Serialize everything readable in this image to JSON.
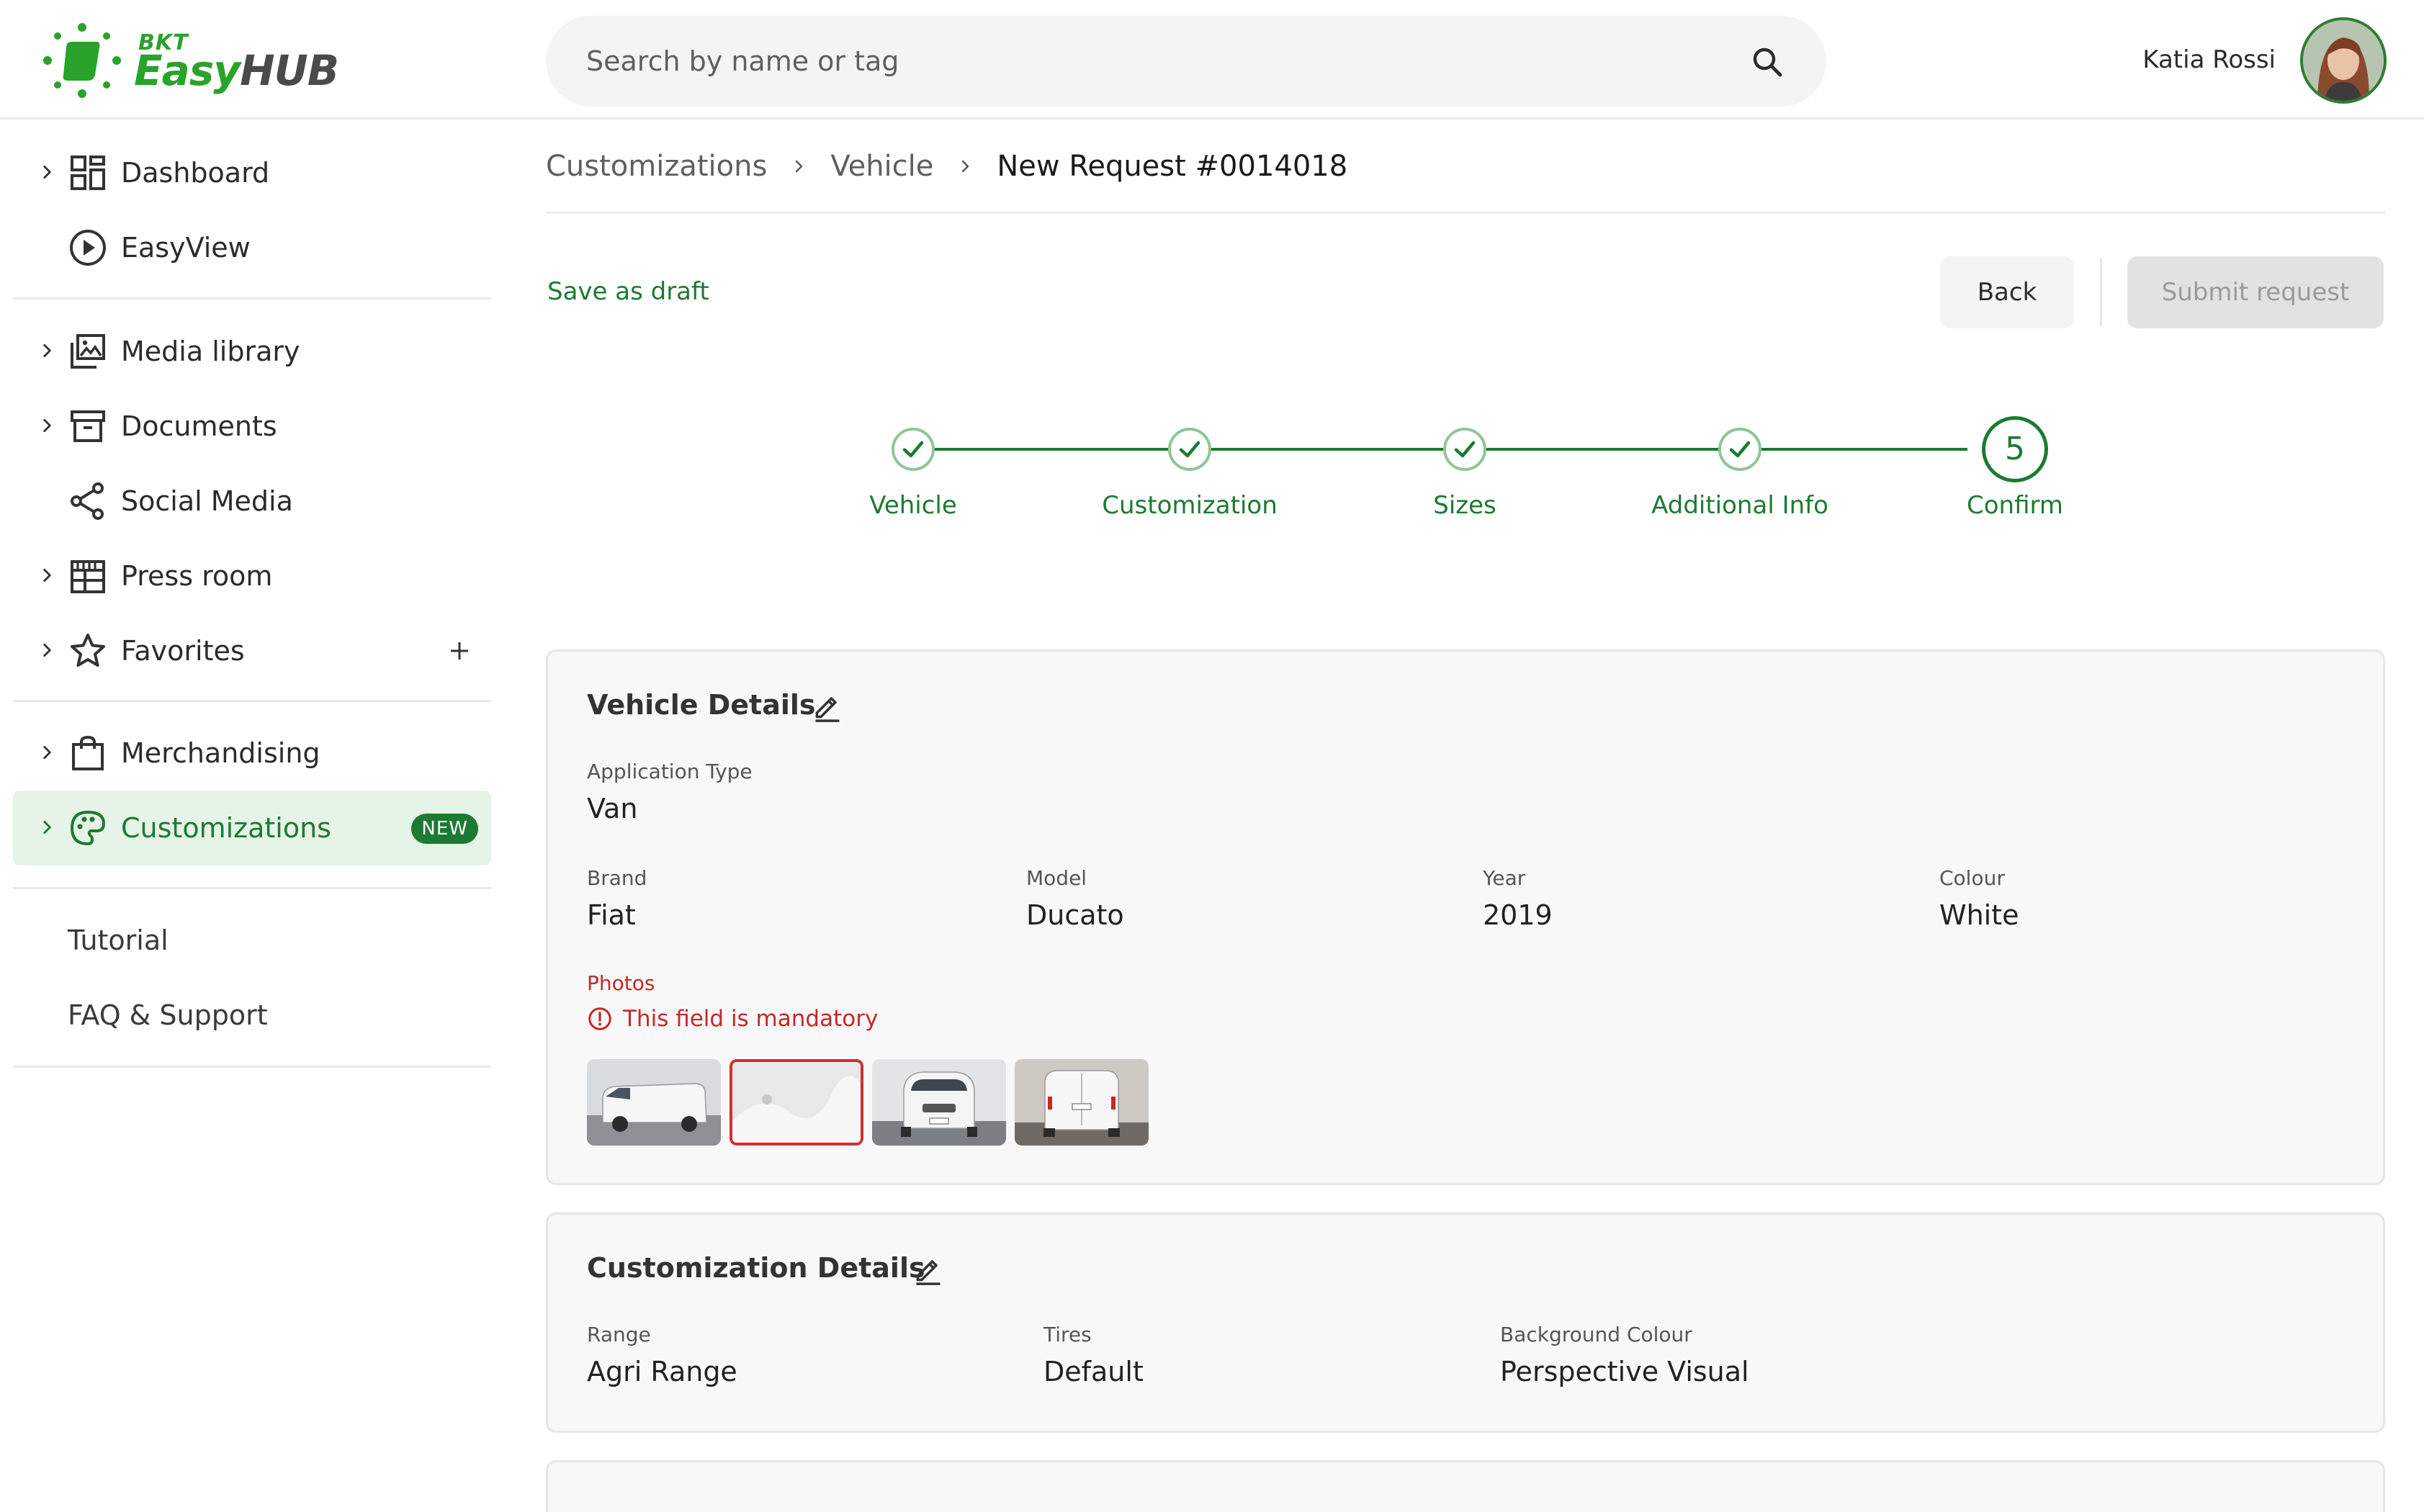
{
  "brand": {
    "logo_small": "BKT",
    "logo_easy": "Easy",
    "logo_hub": "HUB"
  },
  "search": {
    "placeholder": "Search by name or tag"
  },
  "user": {
    "name": "Katia Rossi"
  },
  "sidebar": {
    "items": [
      {
        "label": "Dashboard",
        "icon": "dashboard-icon"
      },
      {
        "label": "EasyView",
        "icon": "play-circle-icon"
      },
      {
        "label": "Media library",
        "icon": "media-library-icon"
      },
      {
        "label": "Documents",
        "icon": "archive-icon"
      },
      {
        "label": "Social Media",
        "icon": "share-icon"
      },
      {
        "label": "Press room",
        "icon": "press-room-icon"
      },
      {
        "label": "Favorites",
        "icon": "star-icon"
      },
      {
        "label": "Merchandising",
        "icon": "shopping-bag-icon"
      },
      {
        "label": "Customizations",
        "icon": "palette-icon",
        "badge": "NEW",
        "active": true
      }
    ],
    "links": [
      {
        "label": "Tutorial"
      },
      {
        "label": "FAQ & Support"
      }
    ]
  },
  "breadcrumb": {
    "items": [
      "Customizations",
      "Vehicle"
    ],
    "current": "New Request #0014018"
  },
  "actions": {
    "save_draft": "Save as draft",
    "back": "Back",
    "submit": "Submit request"
  },
  "stepper": {
    "steps": [
      {
        "label": "Vehicle",
        "state": "done"
      },
      {
        "label": "Customization",
        "state": "done"
      },
      {
        "label": "Sizes",
        "state": "done"
      },
      {
        "label": "Additional Info",
        "state": "done"
      },
      {
        "label": "Confirm",
        "state": "current",
        "number": "5"
      }
    ]
  },
  "vehicle_details": {
    "title": "Vehicle Details",
    "application_type": {
      "label": "Application Type",
      "value": "Van"
    },
    "brand": {
      "label": "Brand",
      "value": "Fiat"
    },
    "model": {
      "label": "Model",
      "value": "Ducato"
    },
    "year": {
      "label": "Year",
      "value": "2019"
    },
    "colour": {
      "label": "Colour",
      "value": "White"
    },
    "photos": {
      "label": "Photos",
      "error": "This field is mandatory"
    }
  },
  "customization_details": {
    "title": "Customization Details",
    "range": {
      "label": "Range",
      "value": "Agri Range"
    },
    "tires": {
      "label": "Tires",
      "value": "Default"
    },
    "background": {
      "label": "Background Colour",
      "value": "Perspective Visual"
    }
  },
  "colors": {
    "primary": "#1c7a32",
    "accent": "#29a329",
    "error": "#c62828"
  }
}
